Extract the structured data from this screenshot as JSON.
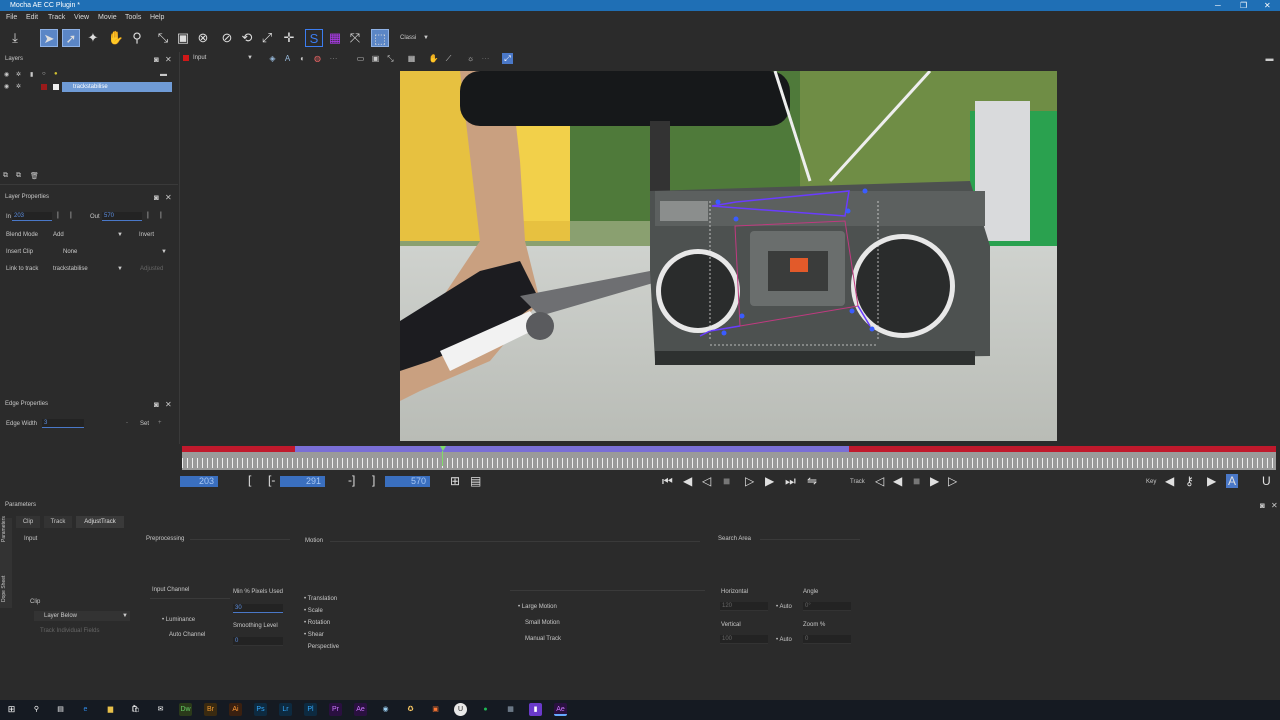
{
  "window": {
    "title": "Mocha AE CC Plugin *"
  },
  "menu": [
    "File",
    "Edit",
    "Track",
    "View",
    "Movie",
    "Tools",
    "Help"
  ],
  "toolbar": {
    "view_mode": "Classi"
  },
  "viewbar": {
    "layer_select": "Input"
  },
  "layers": {
    "header": "Layers",
    "items": [
      {
        "name": "trackstabilise"
      }
    ]
  },
  "layer_properties": {
    "header": "Layer Properties",
    "in_label": "In",
    "in_value": "203",
    "out_label": "Out",
    "out_value": "570",
    "blend_mode_label": "Blend Mode",
    "blend_mode_value": "Add",
    "invert_label": "Invert",
    "insert_clip_label": "Insert Clip",
    "insert_clip_value": "None",
    "link_to_track_label": "Link to track",
    "link_to_track_value": "trackstabilise",
    "adjusted_label": "Adjusted"
  },
  "edge_properties": {
    "header": "Edge Properties",
    "edge_width_label": "Edge Width",
    "edge_width_value": "3",
    "set_label": "Set"
  },
  "transport": {
    "in_frame": "203",
    "current_frame": "291",
    "out_frame": "570",
    "track_label": "Track",
    "key_label": "Key"
  },
  "timeline": {
    "in_fraction": 0.103,
    "current_fraction": 0.239,
    "out_fraction": 0.61
  },
  "parameters": {
    "header": "Parameters",
    "side_tabs": [
      "Parameters",
      "Dope Sheet"
    ],
    "tabs": [
      "Clip",
      "Track",
      "AdjustTrack"
    ],
    "active_tab": "AdjustTrack",
    "sections": {
      "input": "Input",
      "preprocessing": "Preprocessing",
      "motion": "Motion",
      "search_area": "Search Area"
    },
    "clip_label": "Clip",
    "clip_value": "Layer Below",
    "track_individual_fields": "Track Individual Fields",
    "input_channel_label": "Input Channel",
    "luminance": "Luminance",
    "auto_channel": "Auto Channel",
    "min_pixels_label": "Min % Pixels Used",
    "min_pixels_value": "30",
    "smoothing_label": "Smoothing Level",
    "smoothing_value": "0",
    "motion_options": [
      "Translation",
      "Scale",
      "Rotation",
      "Shear",
      "Perspective"
    ],
    "motion_checked": [
      true,
      true,
      true,
      true,
      false
    ],
    "search_options": [
      "Large Motion",
      "Small Motion",
      "Manual Track"
    ],
    "search_selected": "Large Motion",
    "horizontal_label": "Horizontal",
    "horizontal_value": "120",
    "vertical_label": "Vertical",
    "vertical_value": "100",
    "auto_label": "Auto",
    "angle_label": "Angle",
    "angle_value": "0°",
    "zoom_label": "Zoom %",
    "zoom_value": "0"
  },
  "colors": {
    "accent": "#4a78c8",
    "titlebar": "#1f6fb5",
    "timeline_red": "#c0192c",
    "timeline_range": "#7a6fd6",
    "spline": "#6a3cff"
  }
}
